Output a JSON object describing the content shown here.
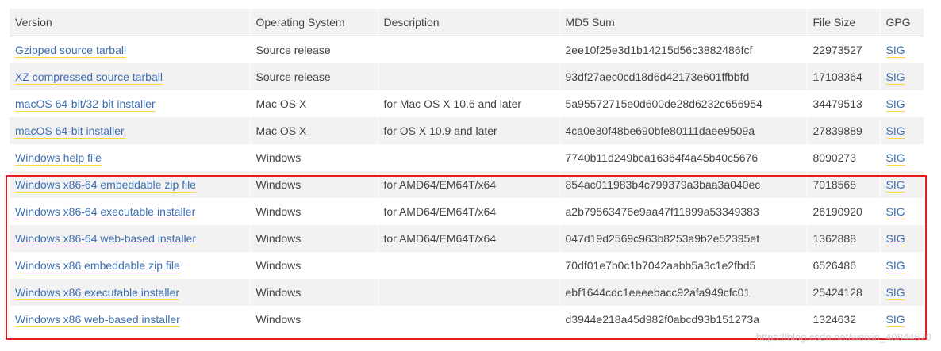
{
  "table": {
    "headers": [
      "Version",
      "Operating System",
      "Description",
      "MD5 Sum",
      "File Size",
      "GPG"
    ],
    "rows": [
      {
        "version": "Gzipped source tarball",
        "os": "Source release",
        "description": "",
        "md5": "2ee10f25e3d1b14215d56c3882486fcf",
        "size": "22973527",
        "gpg": "SIG"
      },
      {
        "version": "XZ compressed source tarball",
        "os": "Source release",
        "description": "",
        "md5": "93df27aec0cd18d6d42173e601ffbbfd",
        "size": "17108364",
        "gpg": "SIG"
      },
      {
        "version": "macOS 64-bit/32-bit installer",
        "os": "Mac OS X",
        "description": "for Mac OS X 10.6 and later",
        "md5": "5a95572715e0d600de28d6232c656954",
        "size": "34479513",
        "gpg": "SIG"
      },
      {
        "version": "macOS 64-bit installer",
        "os": "Mac OS X",
        "description": "for OS X 10.9 and later",
        "md5": "4ca0e30f48be690bfe80111daee9509a",
        "size": "27839889",
        "gpg": "SIG"
      },
      {
        "version": "Windows help file",
        "os": "Windows",
        "description": "",
        "md5": "7740b11d249bca16364f4a45b40c5676",
        "size": "8090273",
        "gpg": "SIG"
      },
      {
        "version": "Windows x86-64 embeddable zip file",
        "os": "Windows",
        "description": "for AMD64/EM64T/x64",
        "md5": "854ac011983b4c799379a3baa3a040ec",
        "size": "7018568",
        "gpg": "SIG"
      },
      {
        "version": "Windows x86-64 executable installer",
        "os": "Windows",
        "description": "for AMD64/EM64T/x64",
        "md5": "a2b79563476e9aa47f11899a53349383",
        "size": "26190920",
        "gpg": "SIG"
      },
      {
        "version": "Windows x86-64 web-based installer",
        "os": "Windows",
        "description": "for AMD64/EM64T/x64",
        "md5": "047d19d2569c963b8253a9b2e52395ef",
        "size": "1362888",
        "gpg": "SIG"
      },
      {
        "version": "Windows x86 embeddable zip file",
        "os": "Windows",
        "description": "",
        "md5": "70df01e7b0c1b7042aabb5a3c1e2fbd5",
        "size": "6526486",
        "gpg": "SIG"
      },
      {
        "version": "Windows x86 executable installer",
        "os": "Windows",
        "description": "",
        "md5": "ebf1644cdc1eeeebacc92afa949cfc01",
        "size": "25424128",
        "gpg": "SIG"
      },
      {
        "version": "Windows x86 web-based installer",
        "os": "Windows",
        "description": "",
        "md5": "d3944e218a45d982f0abcd93b151273a",
        "size": "1324632",
        "gpg": "SIG"
      }
    ]
  },
  "watermark": "https://blog.csdn.net/weixin_40844570",
  "colors": {
    "link": "#3d6fb0",
    "link_underline": "#ffd343",
    "header_bg": "#f2f2f2",
    "stripe_bg": "#f2f2f2",
    "highlight_border": "#e02020"
  }
}
